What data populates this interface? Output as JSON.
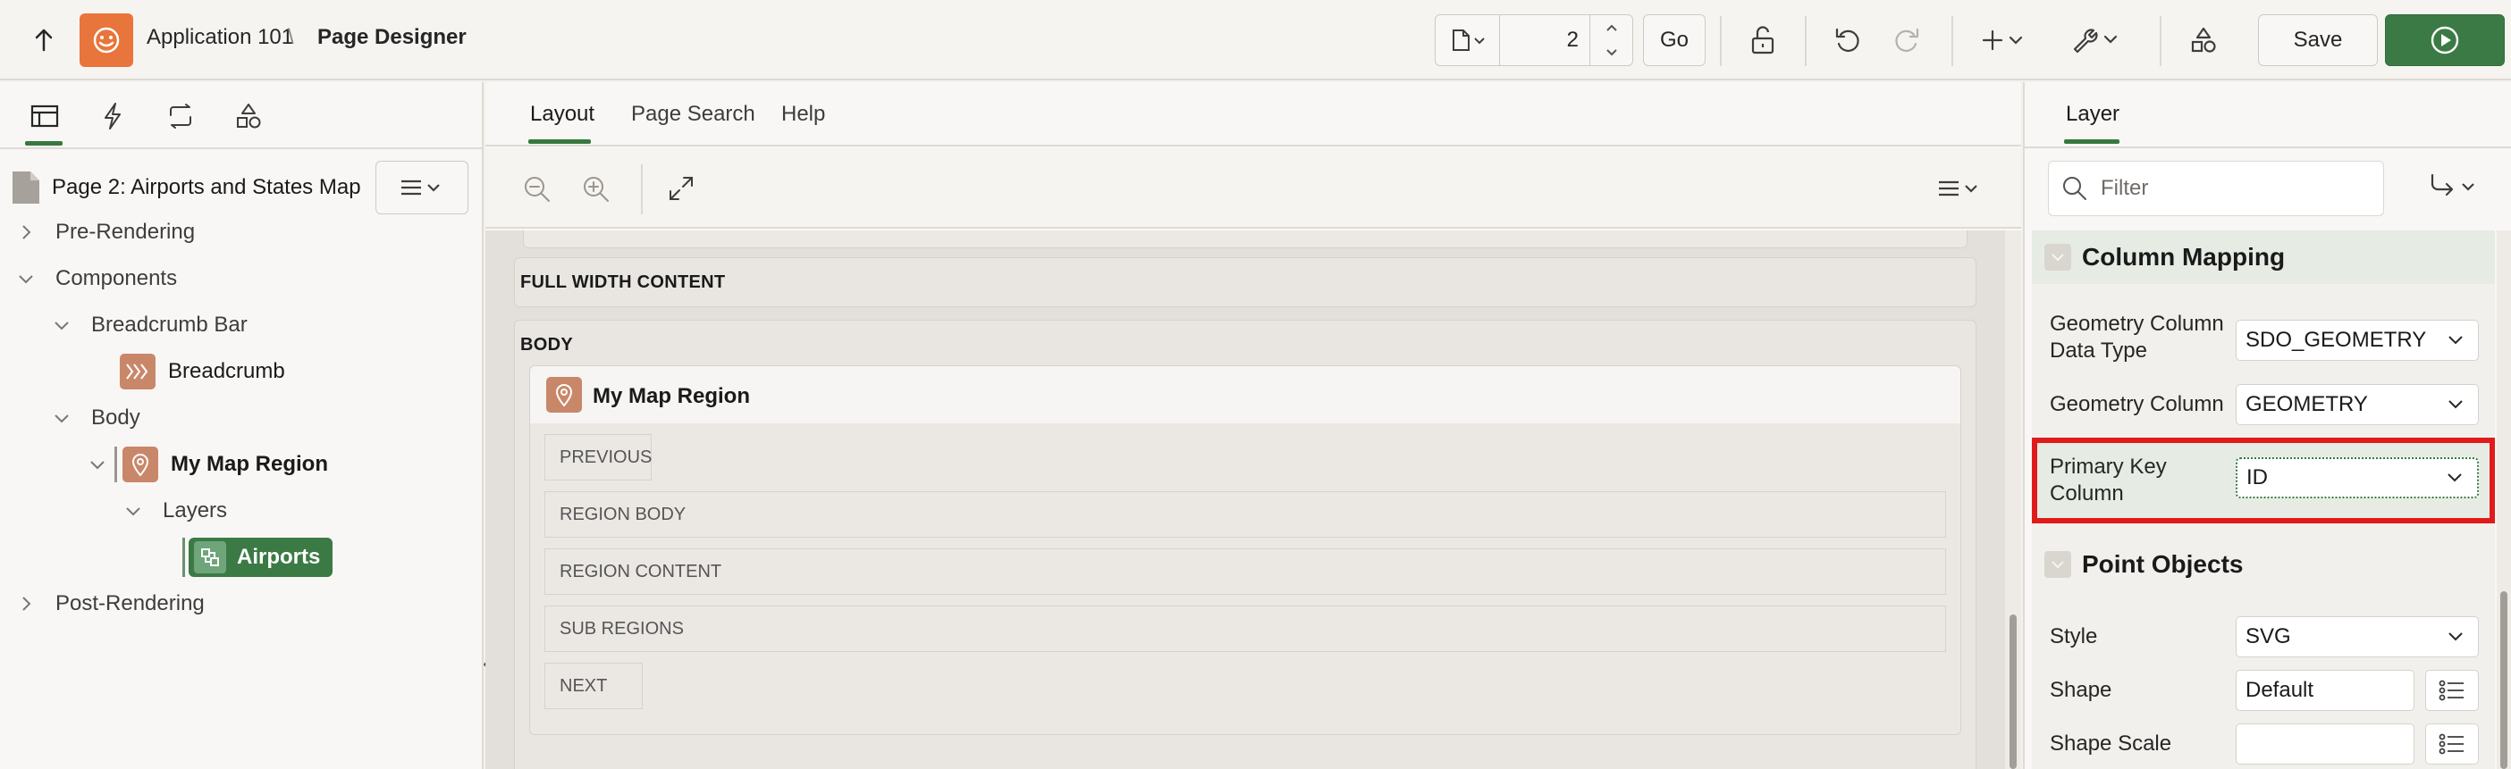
{
  "header": {
    "app_name": "Application 101",
    "separator": "\\",
    "page_title": "Page Designer",
    "page_number": "2",
    "go_label": "Go",
    "save_label": "Save"
  },
  "left_panel": {
    "page_label": "Page 2: Airports and States Map",
    "tree": [
      {
        "label": "Pre-Rendering"
      },
      {
        "label": "Components"
      },
      {
        "label": "Breadcrumb Bar"
      },
      {
        "label": "Breadcrumb"
      },
      {
        "label": "Body"
      },
      {
        "label": "My Map Region"
      },
      {
        "label": "Layers"
      },
      {
        "label": "Airports"
      },
      {
        "label": "Post-Rendering"
      }
    ]
  },
  "center": {
    "tabs": [
      {
        "label": "Layout"
      },
      {
        "label": "Page Search"
      },
      {
        "label": "Help"
      }
    ],
    "full_width_label": "FULL WIDTH CONTENT",
    "body_label": "BODY",
    "region_title": "My Map Region",
    "region_slots": [
      "PREVIOUS",
      "REGION BODY",
      "REGION CONTENT",
      "SUB REGIONS",
      "NEXT"
    ]
  },
  "right_panel": {
    "tab_label": "Layer",
    "filter_placeholder": "Filter",
    "groups": {
      "column_mapping": "Column Mapping",
      "point_objects": "Point Objects"
    },
    "props": {
      "geom_type_label": "Geometry Column Data Type",
      "geom_type_value": "SDO_GEOMETRY",
      "geom_col_label": "Geometry Column",
      "geom_col_value": "GEOMETRY",
      "pk_label": "Primary Key Column",
      "pk_value": "ID",
      "style_label": "Style",
      "style_value": "SVG",
      "shape_label": "Shape",
      "shape_value": "Default",
      "shape_scale_label": "Shape Scale",
      "shape_scale_value": ""
    }
  },
  "colors": {
    "accent_green": "#37783f",
    "run_green": "#3b7a45",
    "logo_orange": "#e8753b",
    "highlight_red": "#e01b1b",
    "node_icon": "#c9876a"
  }
}
